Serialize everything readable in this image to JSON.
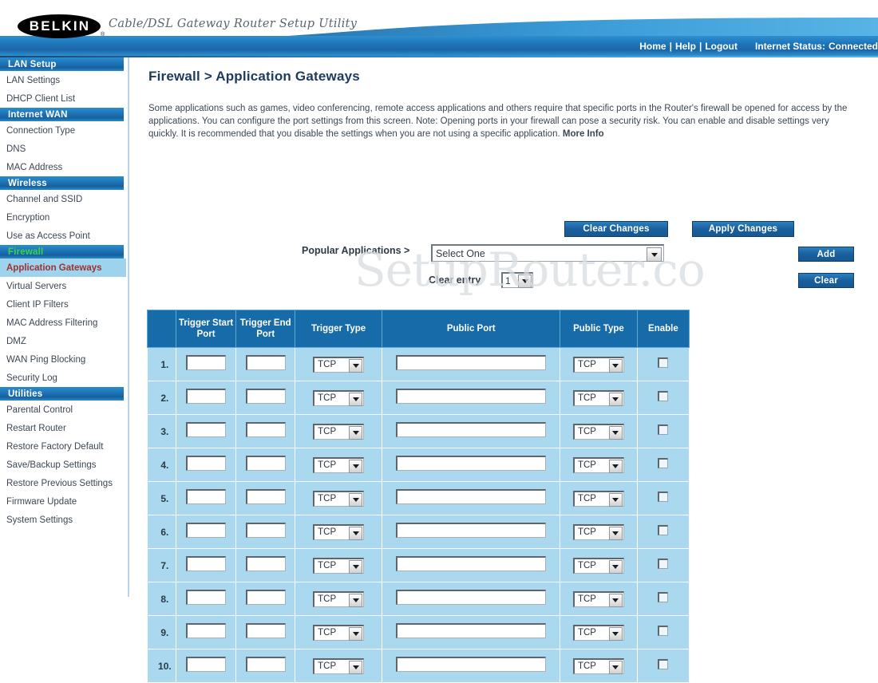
{
  "banner": {
    "logo": "BELKIN",
    "tagline": "Cable/DSL Gateway Router Setup Utility",
    "trademark": "®"
  },
  "topnav": {
    "home": "Home",
    "help": "Help",
    "logout": "Logout",
    "separator": "|",
    "status_label": "Internet Status:",
    "status_value": "Connected",
    "status_color": "#35e03a"
  },
  "sidebar": {
    "sections": [
      {
        "header": "LAN Setup",
        "items": [
          {
            "label": "LAN Settings",
            "active": false
          },
          {
            "label": "DHCP Client List",
            "active": false
          }
        ]
      },
      {
        "header": "Internet WAN",
        "items": [
          {
            "label": "Connection Type",
            "active": false
          },
          {
            "label": "DNS",
            "active": false
          },
          {
            "label": "MAC Address",
            "active": false
          }
        ]
      },
      {
        "header": "Wireless",
        "items": [
          {
            "label": "Channel and SSID",
            "active": false
          },
          {
            "label": "Encryption",
            "active": false
          },
          {
            "label": "Use as Access Point",
            "active": false
          }
        ]
      },
      {
        "header": "Firewall",
        "header_color": "#3ad34a",
        "items": [
          {
            "label": "Application Gateways",
            "active": true
          },
          {
            "label": "Virtual Servers",
            "active": false
          },
          {
            "label": "Client IP Filters",
            "active": false
          },
          {
            "label": "MAC Address Filtering",
            "active": false
          },
          {
            "label": "DMZ",
            "active": false
          },
          {
            "label": "WAN Ping Blocking",
            "active": false
          },
          {
            "label": "Security Log",
            "active": false
          }
        ]
      },
      {
        "header": "Utilities",
        "items": [
          {
            "label": "Parental Control",
            "active": false
          },
          {
            "label": "Restart Router",
            "active": false
          },
          {
            "label": "Restore Factory Default",
            "active": false
          },
          {
            "label": "Save/Backup Settings",
            "active": false
          },
          {
            "label": "Restore Previous Settings",
            "active": false
          },
          {
            "label": "Firmware Update",
            "active": false
          },
          {
            "label": "System Settings",
            "active": false
          }
        ]
      }
    ]
  },
  "main": {
    "title": "Firewall > Application Gateways",
    "description": "Some applications such as games, video conferencing, remote access applications and others require that specific ports in the Router's firewall be opened for access by the applications. You can configure the port settings from this screen. Note: Opening ports in your firewall can pose a security risk. You can enable and disable settings very quickly. It is recommended that you disable the settings when you are not using a specific application.",
    "more_info": "More Info",
    "watermark": "SetupRouter.co"
  },
  "controls": {
    "clear_changes": "Clear Changes",
    "apply_changes": "Apply Changes",
    "popular_applications_label": "Popular Applications >",
    "popular_applications_value": "Select One",
    "add": "Add",
    "clear_entry_label": "Clear entry",
    "clear_entry_value": "1",
    "clear": "Clear"
  },
  "table": {
    "headers": {
      "number": "",
      "trigger_start_port": "Trigger Start Port",
      "trigger_end_port": "Trigger End Port",
      "trigger_type": "Trigger Type",
      "public_port": "Public Port",
      "public_type": "Public Type",
      "enable": "Enable"
    },
    "rows": [
      {
        "num": "1.",
        "trigger_start_port": "",
        "trigger_end_port": "",
        "trigger_type": "TCP",
        "public_port": "",
        "public_type": "TCP",
        "enable": false
      },
      {
        "num": "2.",
        "trigger_start_port": "",
        "trigger_end_port": "",
        "trigger_type": "TCP",
        "public_port": "",
        "public_type": "TCP",
        "enable": false
      },
      {
        "num": "3.",
        "trigger_start_port": "",
        "trigger_end_port": "",
        "trigger_type": "TCP",
        "public_port": "",
        "public_type": "TCP",
        "enable": false
      },
      {
        "num": "4.",
        "trigger_start_port": "",
        "trigger_end_port": "",
        "trigger_type": "TCP",
        "public_port": "",
        "public_type": "TCP",
        "enable": false
      },
      {
        "num": "5.",
        "trigger_start_port": "",
        "trigger_end_port": "",
        "trigger_type": "TCP",
        "public_port": "",
        "public_type": "TCP",
        "enable": false
      },
      {
        "num": "6.",
        "trigger_start_port": "",
        "trigger_end_port": "",
        "trigger_type": "TCP",
        "public_port": "",
        "public_type": "TCP",
        "enable": false
      },
      {
        "num": "7.",
        "trigger_start_port": "",
        "trigger_end_port": "",
        "trigger_type": "TCP",
        "public_port": "",
        "public_type": "TCP",
        "enable": false
      },
      {
        "num": "8.",
        "trigger_start_port": "",
        "trigger_end_port": "",
        "trigger_type": "TCP",
        "public_port": "",
        "public_type": "TCP",
        "enable": false
      },
      {
        "num": "9.",
        "trigger_start_port": "",
        "trigger_end_port": "",
        "trigger_type": "TCP",
        "public_port": "",
        "public_type": "TCP",
        "enable": false
      },
      {
        "num": "10.",
        "trigger_start_port": "",
        "trigger_end_port": "",
        "trigger_type": "TCP",
        "public_port": "",
        "public_type": "TCP",
        "enable": false
      }
    ]
  }
}
